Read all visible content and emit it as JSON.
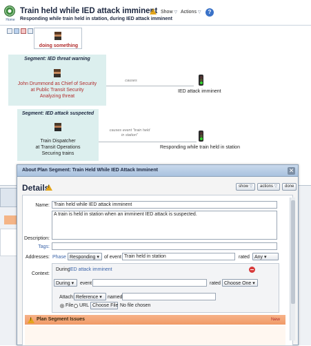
{
  "header": {
    "title": "Train held while IED attack imminent",
    "subtitle": "Responding while train held in station, during IED attack imminent",
    "home_label": "Home",
    "show_menu": "Show",
    "actions_menu": "Actions"
  },
  "toolbar": {
    "icons": [
      "document-icon",
      "edit-icon",
      "delete-icon",
      "print-icon",
      "grid-icon",
      "map-icon",
      "add-icon"
    ]
  },
  "diagram": {
    "agent_label": "doing something",
    "segment1": {
      "title": "Segment: IED threat warning",
      "lines": [
        "John Drummond as Chief of Security",
        "at Public Transit Security",
        "Analyzing threat"
      ]
    },
    "edge1_label": "causes",
    "node1_label": "IED attack imminent",
    "segment2": {
      "title": "Segment: IED attack suspected",
      "lines": [
        "Train Dispatcher",
        "at Transit Operations",
        "Securing trains"
      ]
    },
    "edge2_label": "causes event \"train held in station\"",
    "node2_label": "Responding while train held in station"
  },
  "dialog": {
    "title": "About Plan Segment: Train Held While IED Attack Imminent",
    "close": "✕",
    "details_title": "Details",
    "show_btn": "show",
    "actions_btn": "actions",
    "done_btn": "done",
    "name_label": "Name:",
    "name_value": "Train held while IED attack imminent",
    "description_label": "Description:",
    "description_value": "A train is held in station when an imminent IED attack is suspected.",
    "tags_label": "Tags:",
    "addresses_label": "Addresses:",
    "phase_label": "Phase",
    "phase_value": "Responding",
    "of_event_label": "of event",
    "event_value": "Train held in station",
    "rated_label": "rated",
    "rated_value": "Any",
    "context_label": "Context:",
    "during_text": "During",
    "during_link": "IED attack imminent",
    "during_select": "During",
    "event_label": "event",
    "rated2_label": "rated",
    "rated2_value": "Choose One",
    "attach_label": "Attach:",
    "attach_value": "Reference",
    "named_label": "named",
    "file_label": "File",
    "url_label": "URL",
    "choose_file_btn": "Choose File",
    "no_file_text": "No file chosen",
    "issues_title": "Plan Segment Issues",
    "issues_new": "New"
  }
}
